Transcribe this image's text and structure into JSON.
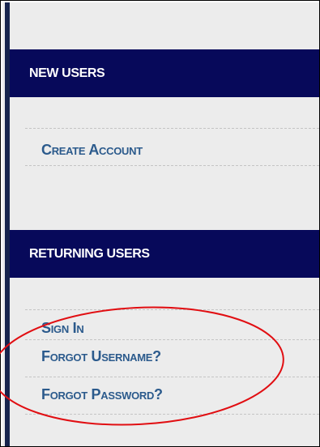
{
  "new_users": {
    "heading": "NEW USERS",
    "create_account_label": "Create Account"
  },
  "returning_users": {
    "heading": "RETURNING USERS",
    "sign_in_label": "Sign In",
    "forgot_username_label": "Forgot Username?",
    "forgot_password_label": "Forgot Password?"
  },
  "colors": {
    "header_background": "#07095a",
    "link_color": "#2b5a8c",
    "annotation_color": "#e10e12",
    "panel_background": "#ececec",
    "left_stripe": "#17244d"
  }
}
